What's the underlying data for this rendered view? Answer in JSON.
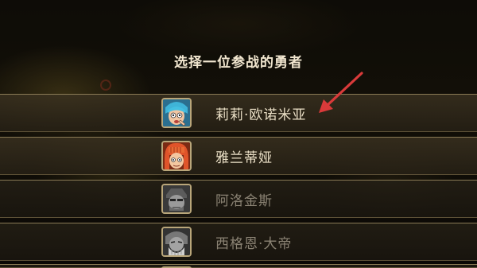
{
  "dialog": {
    "title": "选择一位参战的勇者"
  },
  "heroes": [
    {
      "name": "莉莉·欧诺米亚",
      "portrait_icon": "blue-hair-girl-portrait-icon",
      "available": true,
      "highlighted": true
    },
    {
      "name": "雅兰蒂娅",
      "portrait_icon": "red-hair-girl-portrait-icon",
      "available": true,
      "highlighted": false
    },
    {
      "name": "阿洛金斯",
      "portrait_icon": "grayscale-warrior-portrait-icon",
      "available": false,
      "highlighted": false
    },
    {
      "name": "西格恩·大帝",
      "portrait_icon": "grayscale-elder-portrait-icon",
      "available": false,
      "highlighted": false
    }
  ],
  "annotation": {
    "icon": "red-arrow-icon",
    "color": "#d93a3a"
  },
  "colors": {
    "row_border": "#8a7a55",
    "portrait_frame": "#b9a67a",
    "name_active": "#eadfc6",
    "name_disabled": "#8a8273",
    "title": "#f1e6cf"
  }
}
